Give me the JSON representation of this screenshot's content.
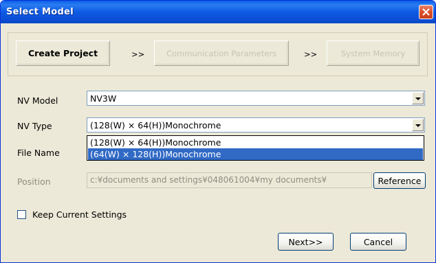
{
  "window": {
    "title": "Select Model"
  },
  "steps": {
    "active": "Create Project",
    "arrow1": ">>",
    "communication": "Communication Parameters",
    "arrow2": ">>",
    "memory": "System Memory"
  },
  "form": {
    "nv_model_label": "NV Model",
    "nv_model_value": "NV3W",
    "nv_type_label": "NV Type",
    "nv_type_value": "(128(W) × 64(H))Monochrome",
    "nv_type_options": [
      "(128(W) × 64(H))Monochrome",
      "(64(W) × 128(H))Monochrome"
    ],
    "file_name_label": "File Name",
    "position_label": "Position",
    "position_value": "c:¥documents and settings¥048061004¥my documents¥",
    "reference_button": "Reference",
    "keep_settings_label": "Keep Current Settings"
  },
  "buttons": {
    "next": "Next>>",
    "cancel": "Cancel"
  },
  "colors": {
    "titlebar": "#0a5ee8",
    "selection": "#316ac5",
    "close": "#d9512c"
  }
}
